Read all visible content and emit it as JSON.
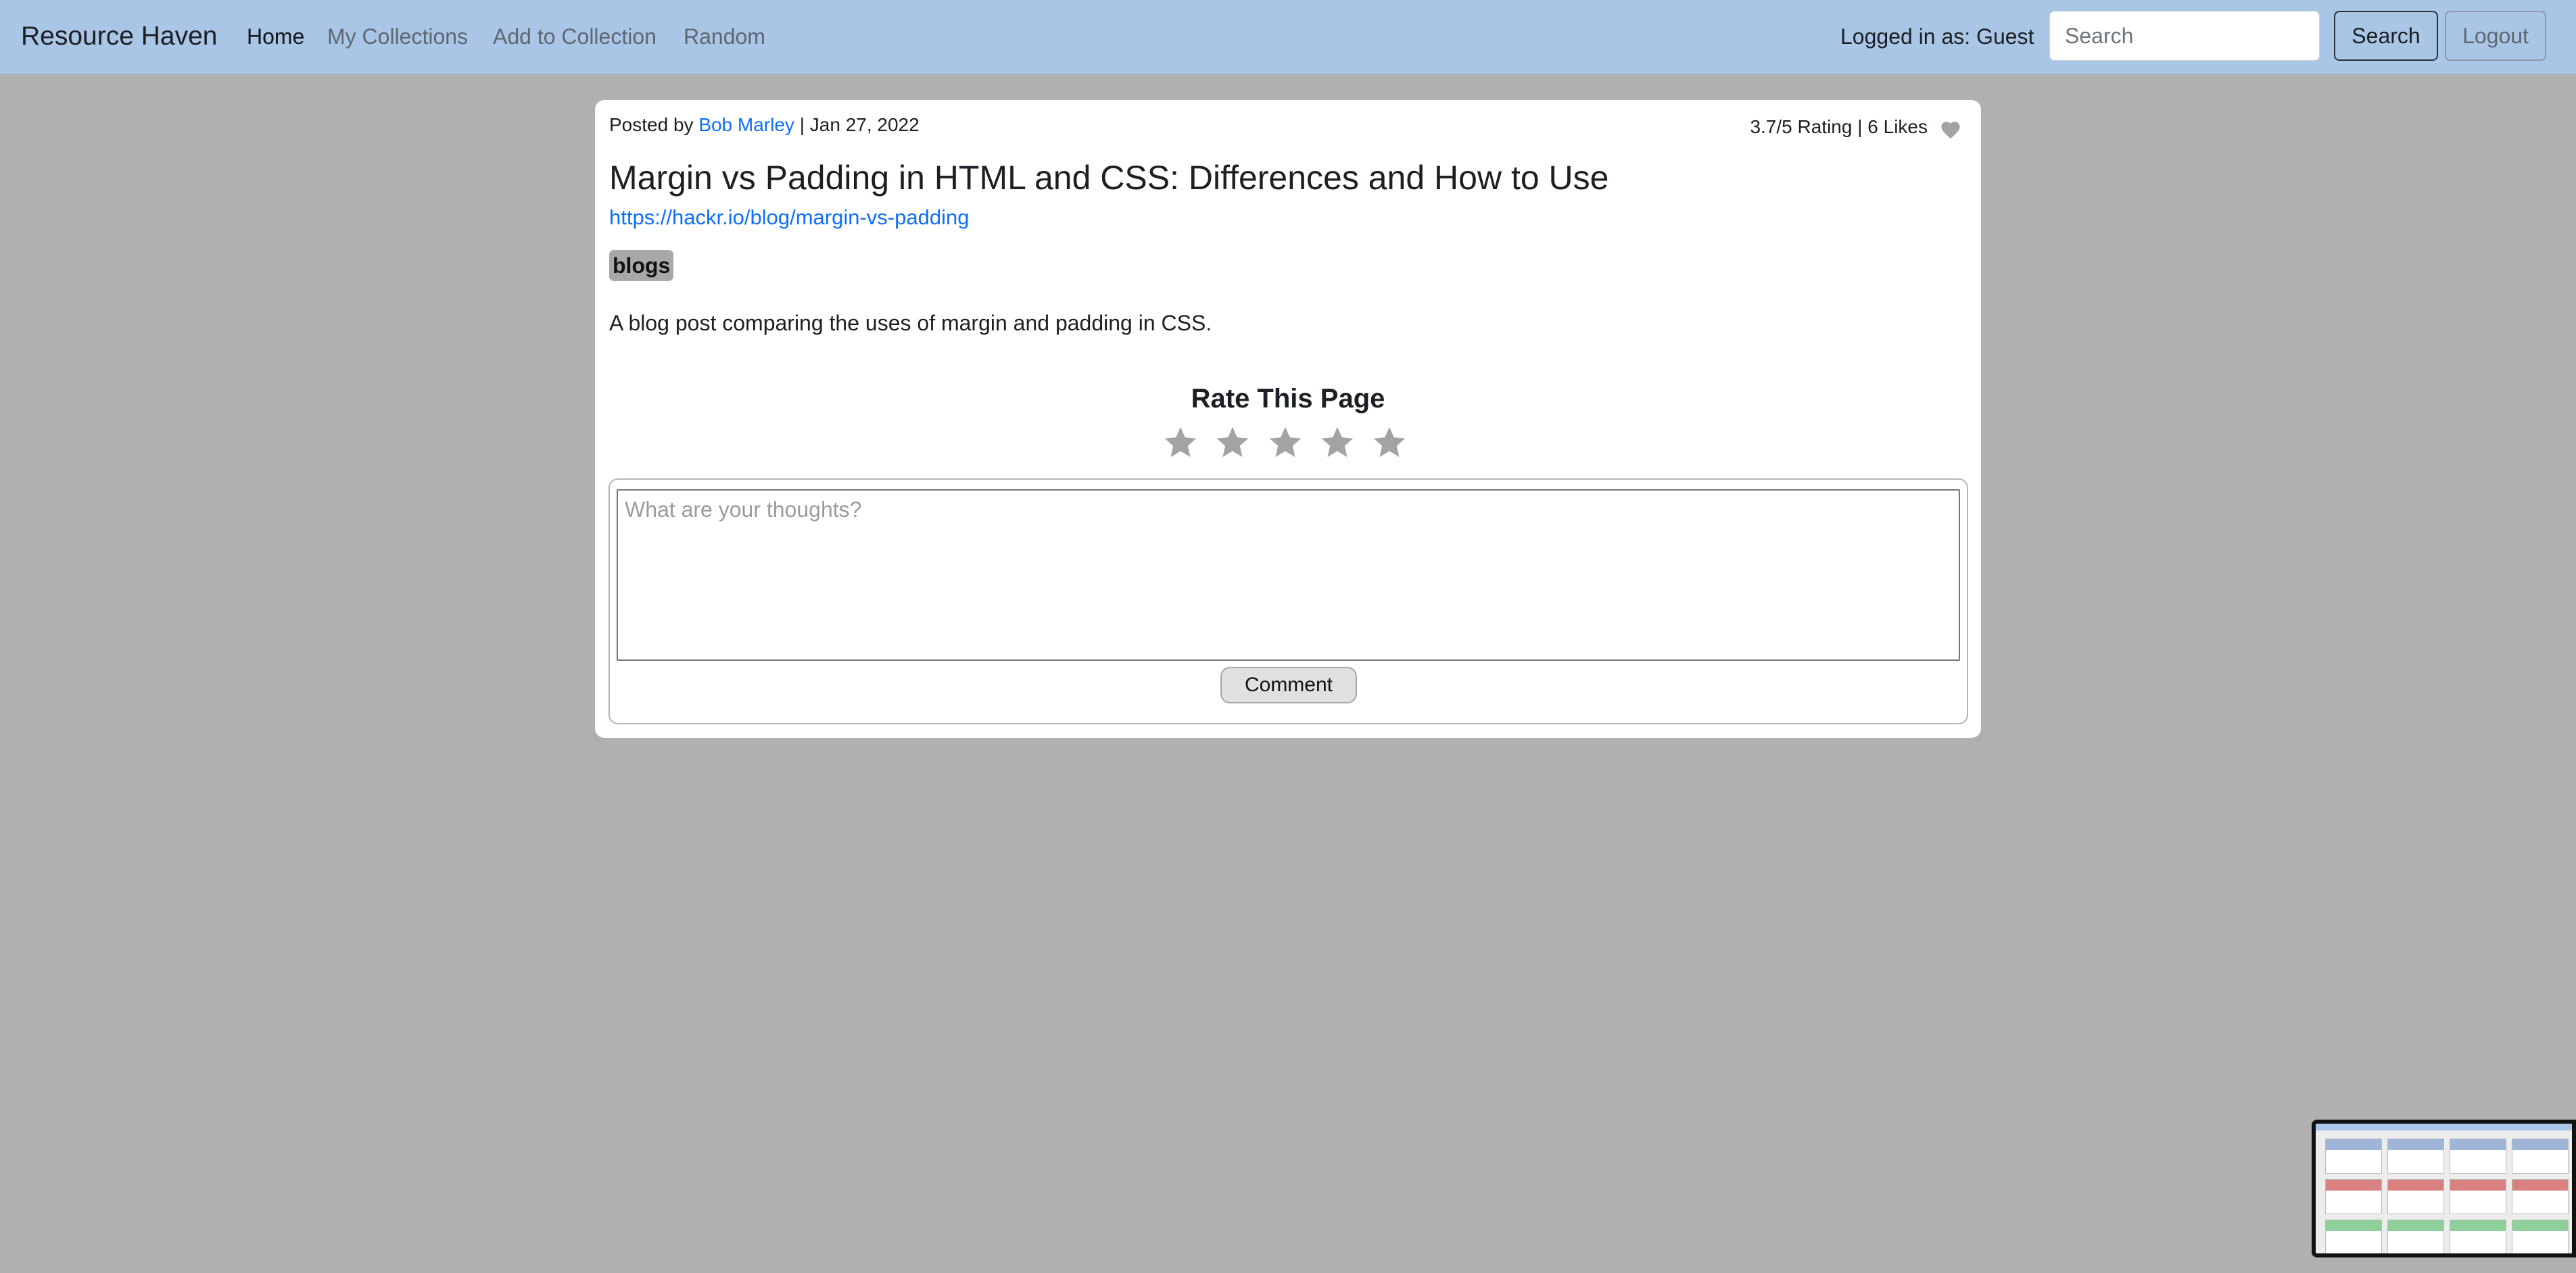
{
  "navbar": {
    "brand": "Resource Haven",
    "links": [
      {
        "label": "Home",
        "active": true
      },
      {
        "label": "My Collections",
        "active": false
      },
      {
        "label": "Add to Collection",
        "active": false
      },
      {
        "label": "Random",
        "active": false
      }
    ],
    "logged_in_text": "Logged in as: Guest",
    "search_placeholder": "Search",
    "search_button": "Search",
    "logout_button": "Logout"
  },
  "post": {
    "posted_by_prefix": "Posted by",
    "author": "Bob Marley",
    "date_text": "| Jan 27, 2022",
    "stats": "3.7/5 Rating | 6 Likes",
    "title": "Margin vs Padding in HTML and CSS: Differences and How to Use",
    "url": "https://hackr.io/blog/margin-vs-padding",
    "tag": "blogs",
    "description": "A blog post comparing the uses of margin and padding in CSS."
  },
  "rating": {
    "title": "Rate This Page",
    "max_stars": 5,
    "selected": 0
  },
  "comment": {
    "placeholder": "What are your thoughts?",
    "button": "Comment"
  },
  "colors": {
    "navbar_bg": "#a9c6e6",
    "page_bg": "#b0b0b0",
    "link": "#0d6efd",
    "star": "#a3a3a3"
  }
}
